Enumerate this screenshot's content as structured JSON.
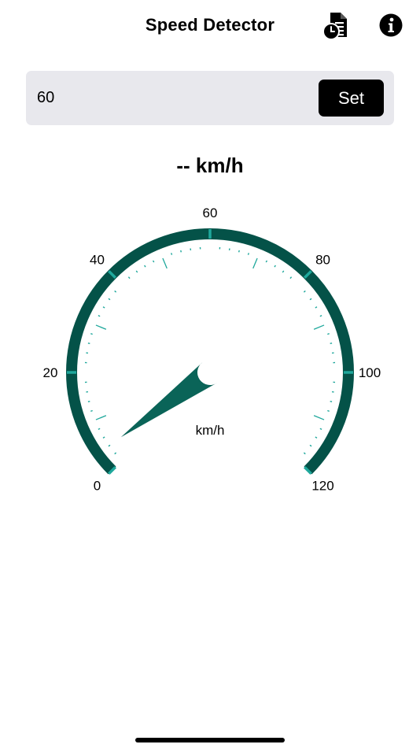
{
  "nav": {
    "title": "Speed Detector",
    "history_icon": "document-clock-icon",
    "info_icon": "info-circle-icon"
  },
  "limit": {
    "value": "60",
    "set_label": "Set"
  },
  "readout": {
    "text": "-- km/h"
  },
  "gauge": {
    "unit": "km/h",
    "min": 0,
    "max": 120,
    "needle_value": 0,
    "labels": [
      "0",
      "20",
      "40",
      "60",
      "80",
      "100",
      "120"
    ],
    "arc_color": "#045248",
    "tick_color": "#1fa89c",
    "needle_color": "#0a6458"
  }
}
